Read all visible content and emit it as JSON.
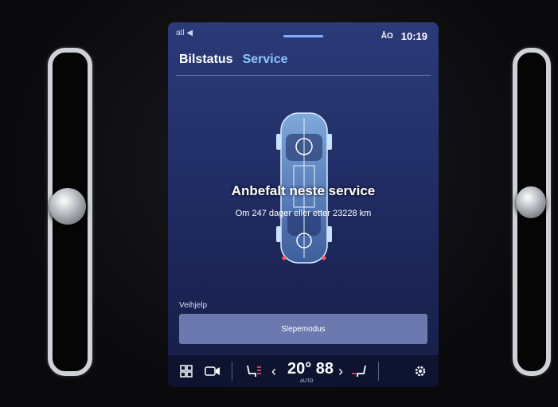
{
  "status_bar": {
    "signal_text": "atl ◀",
    "profile_icon": "person-icon",
    "time_prefix": "ÅO",
    "time": "10:19"
  },
  "tabs": [
    {
      "label": "Bilstatus",
      "active": false
    },
    {
      "label": "Service",
      "active": true
    }
  ],
  "service": {
    "title": "Anbefalt neste service",
    "subtitle": "Om 247 dager eller etter 23228 km"
  },
  "roadside": {
    "section_label": "Veihjelp",
    "tow_mode_label": "Slepemodus"
  },
  "climate": {
    "temperature": "20° 88",
    "mode": "AUTO"
  },
  "colors": {
    "accent": "#8cc6ff",
    "screen_bg": "#23306a",
    "button_bg": "#6b79ae"
  }
}
